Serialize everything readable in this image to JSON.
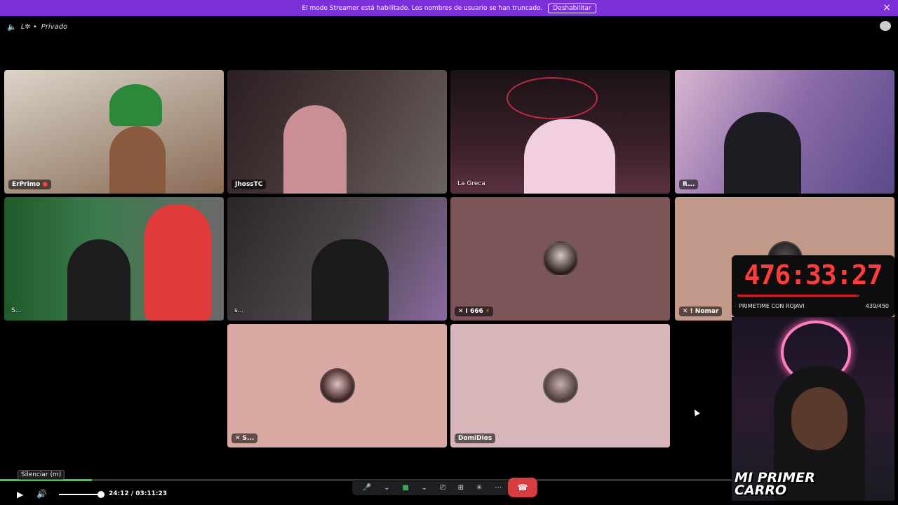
{
  "banner": {
    "message": "El modo Streamer está habilitado. Los nombres de usuario se han truncado.",
    "button_label": "Deshabilitar",
    "close_icon": "×"
  },
  "channel": {
    "name": "Privado",
    "server_label": "L✲ •"
  },
  "tiles": [
    {
      "name": "ErPrimo",
      "style": "badge",
      "bg": "#c7b7a6"
    },
    {
      "name": "JhossTC",
      "style": "badge",
      "bg": "#3a2d2d"
    },
    {
      "name": "La Greca",
      "style": "plain",
      "bg": "#4a2a36"
    },
    {
      "name": "R...",
      "style": "badge",
      "bg": "#6e4f7e"
    },
    {
      "name": "S...",
      "style": "plain",
      "bg": "#27402a"
    },
    {
      "name": "s...",
      "style": "plain",
      "bg": "#2e2a2c"
    },
    {
      "name": "I 666",
      "style": "badge",
      "bg": "#7b5558"
    },
    {
      "name": "! Nomar",
      "style": "badge",
      "bg": "#c39a8a"
    },
    {
      "name": "S...",
      "style": "badge",
      "bg": "#d9a9a4"
    },
    {
      "name": "DomiDios",
      "style": "badge",
      "bg": "#d8b6ba"
    }
  ],
  "overlay": {
    "timer": "476:33:27",
    "label": "PRIMETIME CON ROJAVI",
    "count": "439/450",
    "progress": 0.975,
    "cam_title_line1": "MI PRIMER",
    "cam_title_line2": "CARRO"
  },
  "player": {
    "tooltip": "Silenciar (m)",
    "current_time": "24:12",
    "total_time": "03:11:23",
    "time_display": "24:12 / 03:11:23",
    "progress": 0.126,
    "volume": 1.0
  },
  "colors": {
    "banner": "#7b2fd8",
    "speaking": "#3ea55c",
    "hangup": "#d83c3e",
    "timer": "#ff3b3b"
  }
}
